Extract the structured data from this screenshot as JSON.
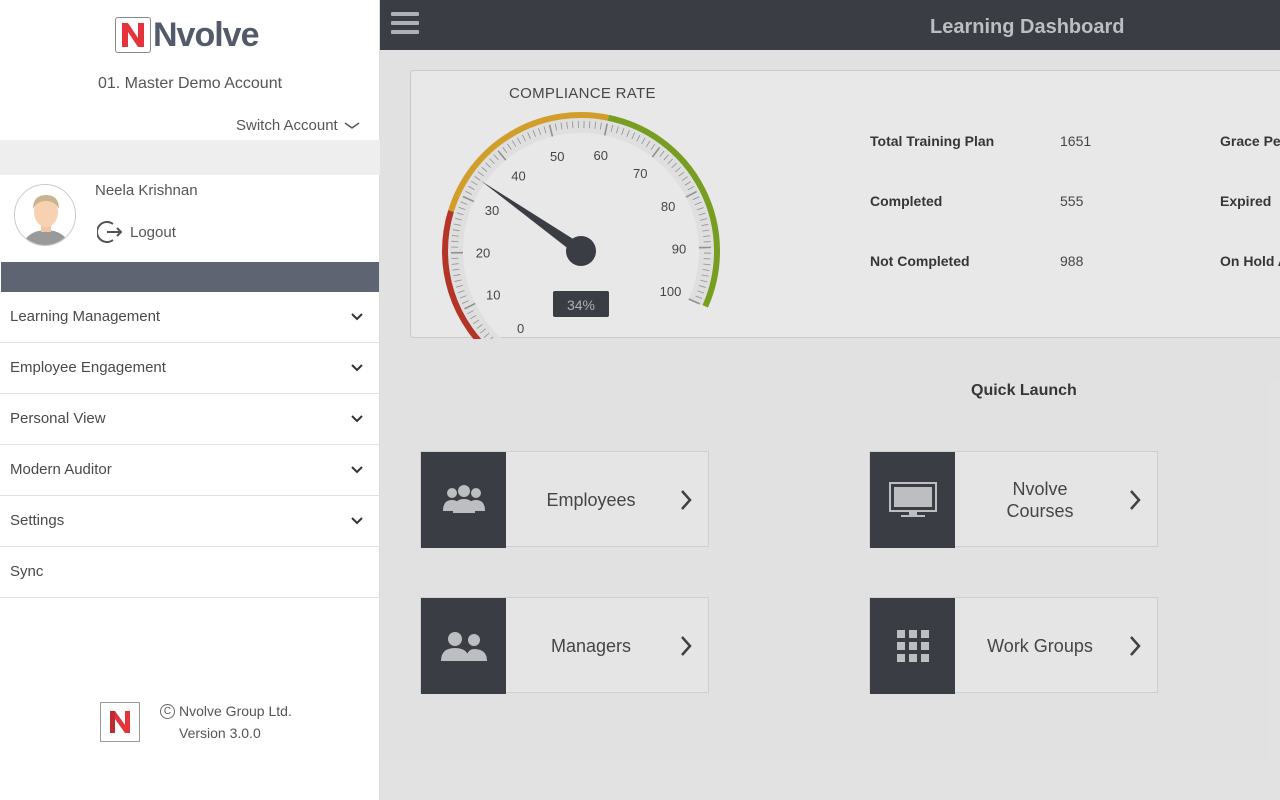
{
  "brand": {
    "logo_letter": "N",
    "logo_text": "Nvolve",
    "color_red": "#e5333b",
    "color_dark": "#3e4149"
  },
  "sidebar": {
    "account_name": "01. Master Demo Account",
    "switch_account_label": "Switch Account",
    "user_name": "Neela Krishnan",
    "logout_label": "Logout",
    "menu": [
      {
        "label": "Learning Management",
        "expandable": true
      },
      {
        "label": "Employee Engagement",
        "expandable": true
      },
      {
        "label": "Personal View",
        "expandable": true
      },
      {
        "label": "Modern Auditor",
        "expandable": true
      },
      {
        "label": "Settings",
        "expandable": true
      },
      {
        "label": "Sync",
        "expandable": false
      }
    ],
    "footer": {
      "copyright": "Nvolve Group Ltd.",
      "version": "Version 3.0.0"
    }
  },
  "header": {
    "title": "Learning Dashboard",
    "menu_icon": "hamburger-icon"
  },
  "compliance": {
    "title": "COMPLIANCE RATE",
    "value_percent": 34,
    "value_label": "34%",
    "ticks": [
      "0",
      "10",
      "20",
      "30",
      "40",
      "50",
      "60",
      "70",
      "80",
      "90",
      "100"
    ],
    "band_colors": [
      "#c0392b",
      "#e0a82e",
      "#7fa823"
    ],
    "stats": [
      {
        "label": "Total Training Plan",
        "value": "1651"
      },
      {
        "label": "Completed",
        "value": "555"
      },
      {
        "label": "Not Completed",
        "value": "988"
      }
    ],
    "stats_right": [
      {
        "label": "Grace Pe"
      },
      {
        "label": "Expired"
      },
      {
        "label": "On Hold A"
      }
    ]
  },
  "quick_launch": {
    "title": "Quick Launch",
    "tiles": [
      {
        "label": "Employees",
        "icon": "employees-group-icon"
      },
      {
        "label": "Nvolve\nCourses",
        "icon": "monitor-icon"
      },
      {
        "label": "Managers",
        "icon": "managers-group-icon"
      },
      {
        "label": "Work Groups",
        "icon": "grid-icon"
      }
    ]
  }
}
